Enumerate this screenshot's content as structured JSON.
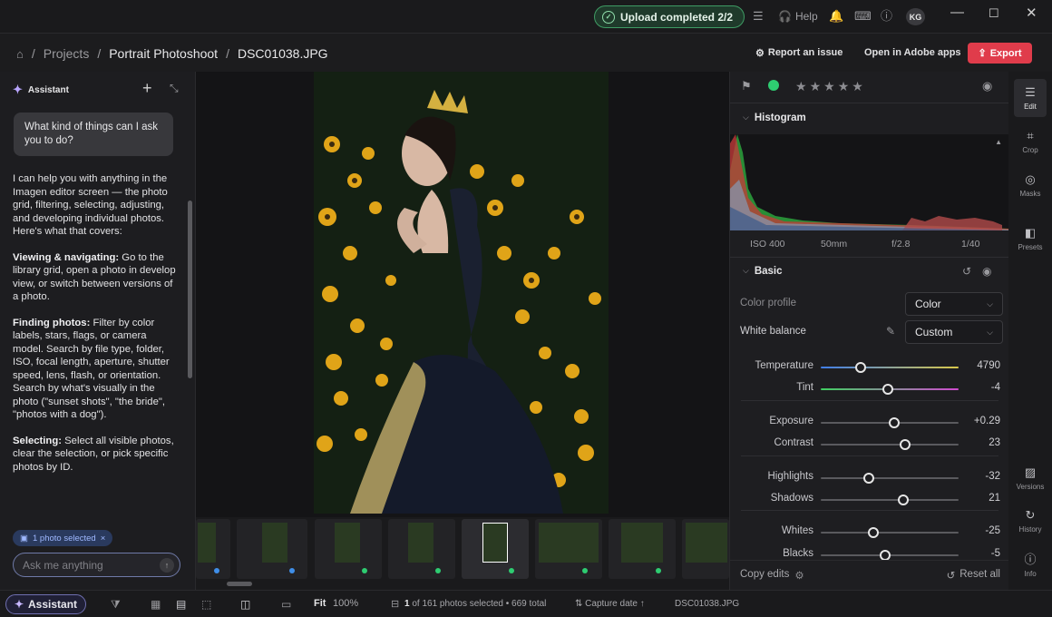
{
  "titlebar": {
    "upload_status": "Upload completed 2/2",
    "help": "Help",
    "avatar": "KG"
  },
  "breadcrumb": {
    "projects": "Projects",
    "project": "Portrait Photoshoot",
    "file": "DSC01038.JPG",
    "sep": "/"
  },
  "actions": {
    "report": "Report an issue",
    "open_adobe": "Open in Adobe apps",
    "export": "Export"
  },
  "assistant": {
    "title": "Assistant",
    "question": "What kind of things can I ask you to do?",
    "intro": "I can help you with anything in the Imagen editor screen — the photo grid, filtering, selecting, adjusting, and developing individual photos. Here's what that covers:",
    "sections": [
      {
        "head": "Viewing & navigating:",
        "text": " Go to the library grid, open a photo in develop view, or switch between versions of a photo."
      },
      {
        "head": "Finding photos:",
        "text": " Filter by color labels, stars, flags, or camera model. Search by file type, folder, ISO, focal length, aperture, shutter speed, lens, flash, or orientation. Search by what's visually in the photo (\"sunset shots\", \"the bride\", \"photos with a dog\")."
      },
      {
        "head": "Selecting:",
        "text": " Select all visible photos, clear the selection, or pick specific photos by ID."
      }
    ],
    "chip": "1 photo selected",
    "placeholder": "Ask me anything"
  },
  "panel": {
    "histogram_title": "Histogram",
    "exif": [
      "ISO 400",
      "50mm",
      "f/2.8",
      "1/40"
    ],
    "basic_title": "Basic",
    "color_profile_label": "Color profile",
    "color_profile_value": "Color",
    "wb_label": "White balance",
    "wb_value": "Custom",
    "sliders": [
      {
        "label": "Temperature",
        "value": "4790",
        "pos": 0.29
      },
      {
        "label": "Tint",
        "value": "-4",
        "pos": 0.49
      },
      {
        "label": "Exposure",
        "value": "+0.29",
        "pos": 0.53
      },
      {
        "label": "Contrast",
        "value": "23",
        "pos": 0.61
      },
      {
        "label": "Highlights",
        "value": "-32",
        "pos": 0.35
      },
      {
        "label": "Shadows",
        "value": "21",
        "pos": 0.6
      },
      {
        "label": "Whites",
        "value": "-25",
        "pos": 0.38
      },
      {
        "label": "Blacks",
        "value": "-5",
        "pos": 0.47
      }
    ],
    "copy_edits": "Copy edits",
    "reset_all": "Reset all"
  },
  "rail": {
    "edit": "Edit",
    "crop": "Crop",
    "masks": "Masks",
    "presets": "Presets",
    "versions": "Versions",
    "history": "History",
    "info": "Info"
  },
  "bottom": {
    "assistant": "Assistant",
    "fit": "Fit",
    "zoom": "100%",
    "selection_count": "1",
    "selection_rest": "of 161 photos selected • 669 total",
    "sort": "Capture date",
    "filename": "DSC01038.JPG"
  },
  "colors": {
    "accent": "#e03c4b",
    "upload_green": "#3f9c64",
    "label_green": "#2ecc71",
    "label_blue": "#3f8ee8"
  }
}
